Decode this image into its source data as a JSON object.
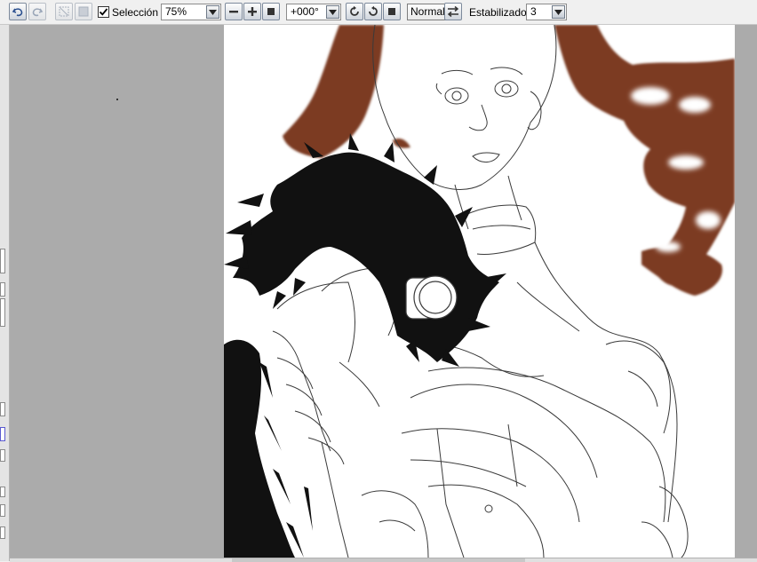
{
  "toolbar": {
    "undo_icon": "undo-icon",
    "redo_icon": "redo-icon",
    "deselect_icon": "deselect-icon",
    "invert_icon": "invert-selection-icon",
    "selection_checked": true,
    "selection_label": "Selección",
    "zoom_value": "75%",
    "rotation_value": "+000°",
    "blend_mode": "Normal",
    "stabilizer_label": "Estabilizador",
    "stabilizer_value": "3"
  },
  "colors": {
    "hair": "#7b3a22",
    "fur": "#111111",
    "line": "#3a3a3a",
    "workspace": "#ababab"
  }
}
